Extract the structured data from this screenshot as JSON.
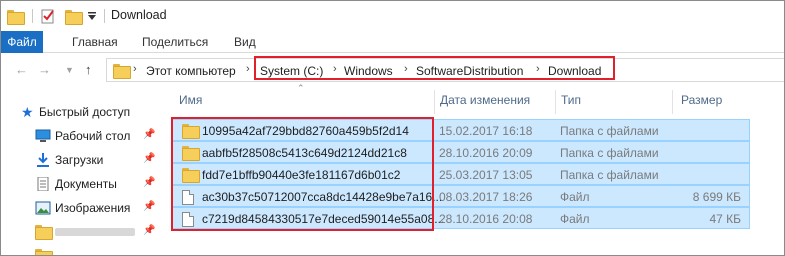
{
  "window": {
    "title": "Download"
  },
  "ribbon": {
    "tabs": [
      "Файл",
      "Главная",
      "Поделиться",
      "Вид"
    ]
  },
  "address": {
    "root": "Этот компьютер",
    "crumbs": [
      "System (C:)",
      "Windows",
      "SoftwareDistribution",
      "Download"
    ]
  },
  "nav": {
    "items": [
      {
        "label": "Быстрый доступ",
        "icon": "star-icon"
      },
      {
        "label": "Рабочий стол",
        "icon": "desktop-icon"
      },
      {
        "label": "Загрузки",
        "icon": "download-icon"
      },
      {
        "label": "Документы",
        "icon": "documents-icon"
      },
      {
        "label": "Изображения",
        "icon": "pictures-icon"
      }
    ]
  },
  "columns": {
    "name": "Имя",
    "date": "Дата изменения",
    "type": "Тип",
    "size": "Размер"
  },
  "files": [
    {
      "name": "10995a42af729bbd82760a459b5f2d14",
      "date": "15.02.2017 16:18",
      "type": "Папка с файлами",
      "size": "",
      "kind": "folder"
    },
    {
      "name": "aabfb5f28508c5413c649d2124dd21c8",
      "date": "28.10.2016 20:09",
      "type": "Папка с файлами",
      "size": "",
      "kind": "folder"
    },
    {
      "name": "fdd7e1bffb90440e3fe181167d6b01c2",
      "date": "25.03.2017 13:05",
      "type": "Папка с файлами",
      "size": "",
      "kind": "folder"
    },
    {
      "name": "ac30b37c50712007cca8dc14428e9be7a16...",
      "date": "08.03.2017 18:26",
      "type": "Файл",
      "size": "8 699 КБ",
      "kind": "file"
    },
    {
      "name": "c7219d84584330517e7deced59014e55a08...",
      "date": "28.10.2016 20:08",
      "type": "Файл",
      "size": "47 КБ",
      "kind": "file"
    }
  ],
  "colors": {
    "accent": "#1a6fc4",
    "selection": "#cce8ff",
    "highlight": "#e0202a"
  }
}
